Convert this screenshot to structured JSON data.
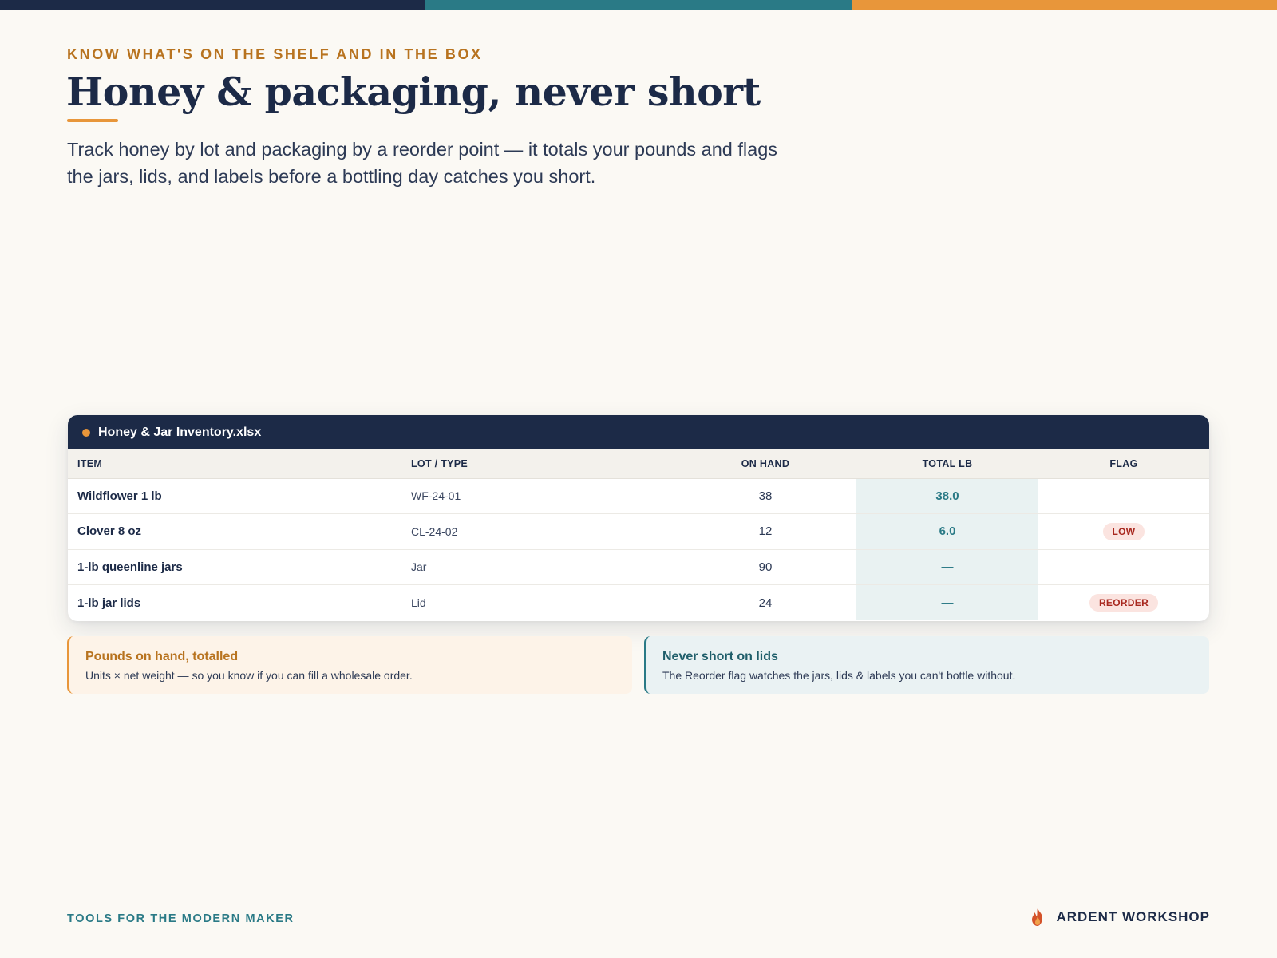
{
  "colors": {
    "navy": "#1c2a47",
    "teal": "#2a7a86",
    "orange": "#e8963a",
    "eyebrow": "#b8731f",
    "background": "#fbf9f4"
  },
  "hero": {
    "eyebrow": "KNOW WHAT'S ON THE SHELF AND IN THE BOX",
    "title": "Honey & packaging, never short",
    "lede": "Track honey by lot and packaging by a reorder point — it totals your pounds and flags the jars, lids, and labels before a bottling day catches you short."
  },
  "sheet": {
    "file_name": "Honey & Jar Inventory.xlsx",
    "columns": [
      "ITEM",
      "LOT / TYPE",
      "ON HAND",
      "TOTAL LB",
      "FLAG"
    ],
    "rows": [
      {
        "item": "Wildflower 1 lb",
        "lot": "WF-24-01",
        "on_hand": "38",
        "total_lb": "38.0",
        "flag": ""
      },
      {
        "item": "Clover 8 oz",
        "lot": "CL-24-02",
        "on_hand": "12",
        "total_lb": "6.0",
        "flag": "LOW"
      },
      {
        "item": "1-lb queenline jars",
        "lot": "Jar",
        "on_hand": "90",
        "total_lb": "—",
        "flag": ""
      },
      {
        "item": "1-lb jar lids",
        "lot": "Lid",
        "on_hand": "24",
        "total_lb": "—",
        "flag": "REORDER"
      }
    ]
  },
  "callouts": [
    {
      "title": "Pounds on hand, totalled",
      "text": "Units × net weight — so you know if you can fill a wholesale order."
    },
    {
      "title": "Never short on lids",
      "text": "The Reorder flag watches the jars, lids & labels you can't bottle without."
    }
  ],
  "footer": {
    "tagline": "TOOLS FOR THE MODERN MAKER",
    "brand": "ARDENT WORKSHOP",
    "brand_icon": "flame-icon"
  }
}
